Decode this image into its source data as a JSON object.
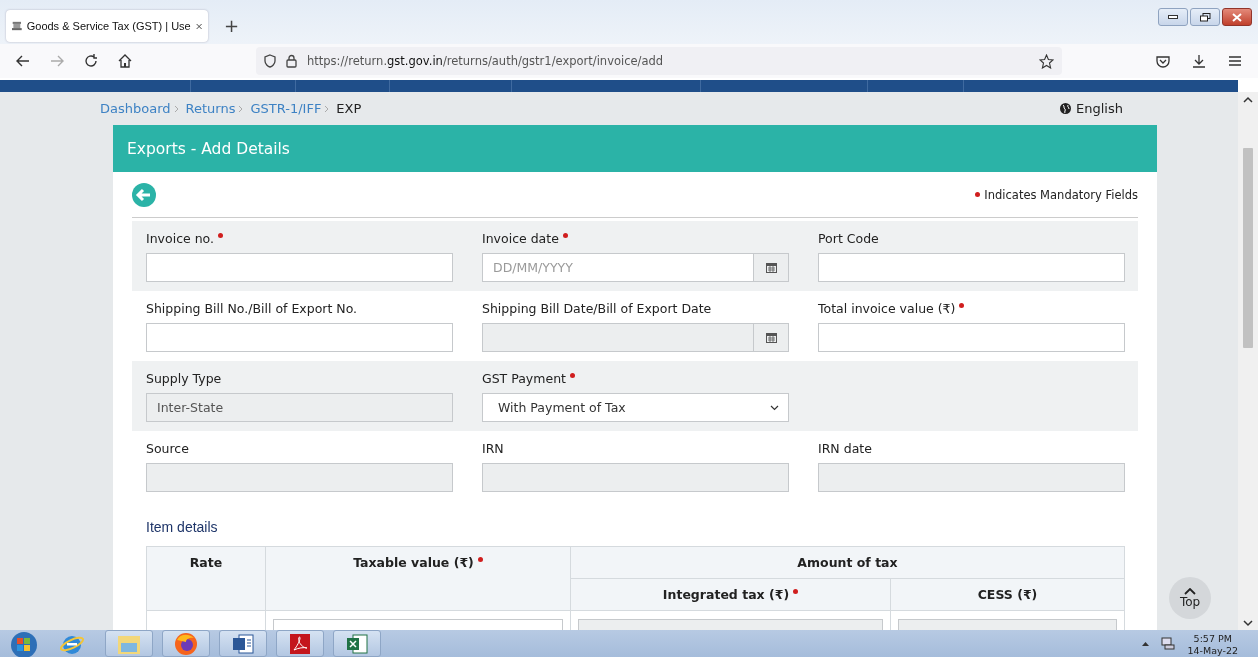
{
  "browser": {
    "tab_title": "Goods & Service Tax (GST) | Use",
    "new_tab": "+",
    "url": "https://return.**gst.gov.in**/returns/auth/gstr1/export/invoice/add"
  },
  "breadcrumb": [
    {
      "label": "Dashboard",
      "current": false
    },
    {
      "label": "Returns",
      "current": false
    },
    {
      "label": "GSTR-1/IFF",
      "current": false
    },
    {
      "label": "EXP",
      "current": true
    }
  ],
  "language": "English",
  "card": {
    "title": "Exports - Add Details",
    "mandatory_note": "Indicates Mandatory Fields"
  },
  "form_rows": [
    {
      "shaded": true,
      "fields": [
        {
          "label": "Invoice no.",
          "required": true,
          "kind": "text",
          "disabled": false
        },
        {
          "label": "Invoice date",
          "required": true,
          "kind": "date",
          "placeholder": "DD/MM/YYYY",
          "disabled": false
        },
        {
          "label": "Port Code",
          "kind": "text",
          "disabled": false
        }
      ]
    },
    {
      "shaded": false,
      "fields": [
        {
          "label": "Shipping Bill No./Bill of Export No.",
          "kind": "text",
          "disabled": false
        },
        {
          "label": "Shipping Bill Date/Bill of Export Date",
          "kind": "date",
          "disabled": true
        },
        {
          "label": "Total invoice value (₹)",
          "required": true,
          "kind": "text",
          "disabled": false
        }
      ]
    },
    {
      "shaded": true,
      "fields": [
        {
          "label": "Supply Type",
          "kind": "text",
          "value": "Inter-State",
          "disabled": true
        },
        {
          "label": "GST Payment",
          "required": true,
          "kind": "select",
          "value": "With Payment of Tax",
          "disabled": false
        }
      ]
    },
    {
      "shaded": false,
      "fields": [
        {
          "label": "Source",
          "kind": "text",
          "disabled": true
        },
        {
          "label": "IRN",
          "kind": "text",
          "disabled": true
        },
        {
          "label": "IRN date",
          "kind": "text",
          "disabled": true
        }
      ]
    }
  ],
  "item_details": {
    "title": "Item details",
    "columns": [
      {
        "label": "Rate"
      },
      {
        "label": "Taxable value (₹)",
        "required": true
      }
    ],
    "group_header": "Amount of tax",
    "sub_columns": [
      {
        "label": "Integrated tax (₹)",
        "required": true
      },
      {
        "label": "CESS (₹)"
      }
    ],
    "row_fields": [
      {
        "disabled": false
      },
      {
        "disabled": true
      },
      {
        "disabled": true
      }
    ]
  },
  "top_button": "Top",
  "taskbar": {
    "time": "5:57 PM",
    "date": "14-May-22"
  }
}
